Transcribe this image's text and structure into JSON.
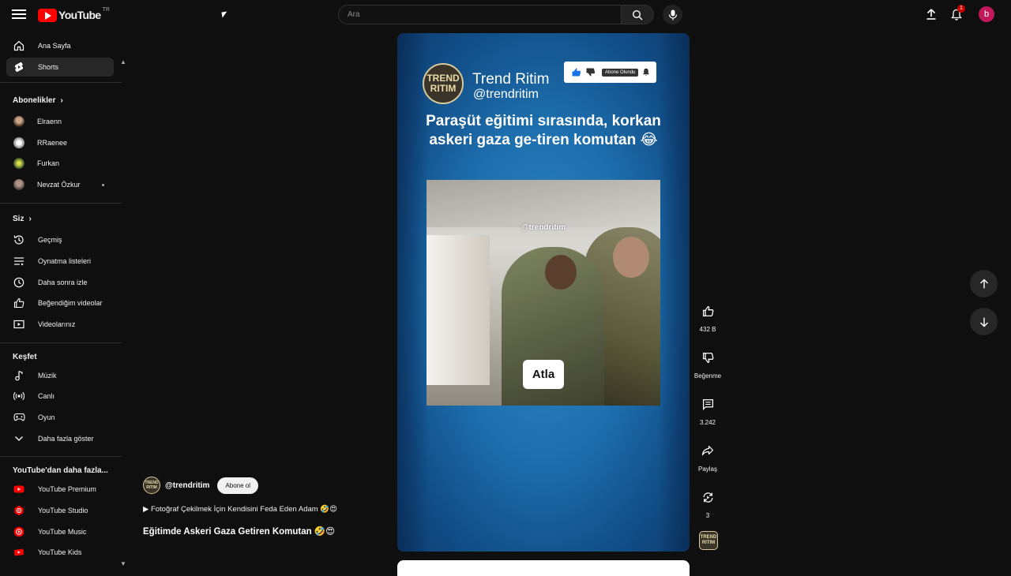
{
  "topbar": {
    "logo_text": "YouTube",
    "logo_country": "TR",
    "search_placeholder": "Ara",
    "notification_count": "1",
    "avatar_letter": "b"
  },
  "sidebar": {
    "main": [
      {
        "label": "Ana Sayfa",
        "icon": "home-icon"
      },
      {
        "label": "Shorts",
        "icon": "shorts-icon"
      }
    ],
    "subscriptions_heading": "Abonelikler",
    "subscriptions": [
      {
        "label": "Elraenn"
      },
      {
        "label": "RRaenee"
      },
      {
        "label": "Furkan"
      },
      {
        "label": "Nevzat Özkur"
      }
    ],
    "you_heading": "Siz",
    "you": [
      {
        "label": "Geçmiş",
        "icon": "history-icon"
      },
      {
        "label": "Oynatma listeleri",
        "icon": "playlist-icon"
      },
      {
        "label": "Daha sonra izle",
        "icon": "clock-icon"
      },
      {
        "label": "Beğendiğim videolar",
        "icon": "thumbs-up-icon"
      },
      {
        "label": "Videolarınız",
        "icon": "video-icon"
      }
    ],
    "explore_heading": "Keşfet",
    "explore": [
      {
        "label": "Müzik",
        "icon": "music-icon"
      },
      {
        "label": "Canlı",
        "icon": "live-icon"
      },
      {
        "label": "Oyun",
        "icon": "gaming-icon"
      },
      {
        "label": "Daha fazla göster",
        "icon": "chevron-down-icon"
      }
    ],
    "more_heading": "YouTube'dan daha fazla...",
    "more": [
      {
        "label": "YouTube Premium"
      },
      {
        "label": "YouTube Studio"
      },
      {
        "label": "YouTube Music"
      },
      {
        "label": "YouTube Kids"
      }
    ]
  },
  "short": {
    "channel_logo_text": "TREND RITIM",
    "channel_name": "Trend Ritim",
    "channel_handle": "@trendritim",
    "promo_tag": "Abone Olundu",
    "caption": "Paraşüt eğitimi sırasında, korkan askeri gaza ge-tiren komutan 😂",
    "clip_handle": "@trendritim",
    "clip_word": "Atla"
  },
  "actions": {
    "like_count": "432 B",
    "dislike_label": "Beğenme",
    "comments_count": "3.242",
    "share_label": "Paylaş",
    "remix_count": "3"
  },
  "meta": {
    "channel_handle": "@trendritim",
    "subscribe_label": "Abone ol",
    "link_text": "▶ Fotoğraf Çekilmek İçin Kendisini Feda Eden Adam 🤣😍",
    "title": "Eğitimde Askeri Gaza Getiren Komutan 🤣😍"
  }
}
